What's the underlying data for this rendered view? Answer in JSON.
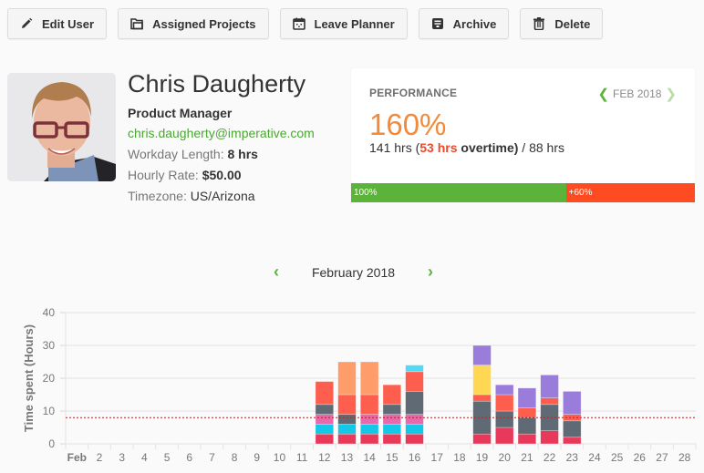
{
  "toolbar": {
    "buttons": [
      {
        "label": "Edit User",
        "icon": "pencil-icon"
      },
      {
        "label": "Assigned Projects",
        "icon": "folder-icon"
      },
      {
        "label": "Leave Planner",
        "icon": "calendar-icon"
      },
      {
        "label": "Archive",
        "icon": "archive-icon"
      },
      {
        "label": "Delete",
        "icon": "trash-icon"
      }
    ]
  },
  "profile": {
    "name": "Chris Daugherty",
    "title": "Product Manager",
    "email": "chris.daugherty@imperative.com",
    "workday_label": "Workday Length:",
    "workday_value": "8 hrs",
    "rate_label": "Hourly Rate:",
    "rate_value": "$50.00",
    "timezone_label": "Timezone:",
    "timezone_value": "US/Arizona"
  },
  "performance": {
    "heading": "PERFORMANCE",
    "period": "FEB 2018",
    "percent": "160%",
    "hours_total": "141 hrs (",
    "overtime_hours": "53 hrs",
    "overtime_label": " overtime)",
    "expected": " / 88 hrs",
    "bar": {
      "base_label": "100%",
      "over_label": "+60%",
      "base_fraction": 0.625,
      "over_fraction": 0.375,
      "base_color": "#5cb33a",
      "over_color": "#fe4b21"
    }
  },
  "calendar": {
    "month_label": "February 2018",
    "prev_icon": "chevron-left-icon",
    "next_icon": "chevron-right-icon"
  },
  "chart_data": {
    "type": "bar",
    "stacked": true,
    "ylabel": "Time spent (Hours)",
    "xlabel": "",
    "ylim": [
      0,
      40
    ],
    "yticks": [
      0,
      10,
      20,
      30,
      40
    ],
    "grid": true,
    "reference_line": {
      "value": 8,
      "style": "dotted",
      "color": "#b22222"
    },
    "categories": [
      "Feb",
      "2",
      "3",
      "4",
      "5",
      "6",
      "7",
      "8",
      "9",
      "10",
      "11",
      "12",
      "13",
      "14",
      "15",
      "16",
      "17",
      "18",
      "19",
      "20",
      "21",
      "22",
      "23",
      "24",
      "25",
      "26",
      "27",
      "28"
    ],
    "series": [
      {
        "name": "crimson",
        "color": "#e8395a",
        "values": [
          0,
          0,
          0,
          0,
          0,
          0,
          0,
          0,
          0,
          0,
          0,
          3,
          3,
          3,
          3,
          3,
          0,
          0,
          3,
          5,
          3,
          4,
          2,
          0,
          0,
          0,
          0,
          0
        ]
      },
      {
        "name": "cyan",
        "color": "#13c8e6",
        "values": [
          0,
          0,
          0,
          0,
          0,
          0,
          0,
          0,
          0,
          0,
          0,
          3,
          3,
          3,
          3,
          3,
          0,
          0,
          0,
          0,
          0,
          0,
          0,
          0,
          0,
          0,
          0,
          0
        ]
      },
      {
        "name": "pink",
        "color": "#e569ab",
        "values": [
          0,
          0,
          0,
          0,
          0,
          0,
          0,
          0,
          0,
          0,
          0,
          3,
          0,
          3,
          3,
          3,
          0,
          0,
          0,
          0,
          0,
          0,
          0,
          0,
          0,
          0,
          0,
          0
        ]
      },
      {
        "name": "slate",
        "color": "#5f6a74",
        "values": [
          0,
          0,
          0,
          0,
          0,
          0,
          0,
          0,
          0,
          0,
          0,
          3,
          3,
          0,
          3,
          7,
          0,
          0,
          10,
          5,
          5,
          8,
          5,
          0,
          0,
          0,
          0,
          0
        ]
      },
      {
        "name": "red",
        "color": "#fe5e4e",
        "values": [
          0,
          0,
          0,
          0,
          0,
          0,
          0,
          0,
          0,
          0,
          0,
          7,
          6,
          6,
          6,
          6,
          0,
          0,
          2,
          5,
          3,
          2,
          2,
          0,
          0,
          0,
          0,
          0
        ]
      },
      {
        "name": "salmon",
        "color": "#ff9d6a",
        "values": [
          0,
          0,
          0,
          0,
          0,
          0,
          0,
          0,
          0,
          0,
          0,
          0,
          10,
          10,
          0,
          0,
          0,
          0,
          0,
          0,
          0,
          0,
          0,
          0,
          0,
          0,
          0,
          0
        ]
      },
      {
        "name": "sky",
        "color": "#52daf5",
        "values": [
          0,
          0,
          0,
          0,
          0,
          0,
          0,
          0,
          0,
          0,
          0,
          0,
          0,
          0,
          0,
          2,
          0,
          0,
          0,
          0,
          0,
          0,
          0,
          0,
          0,
          0,
          0,
          0
        ]
      },
      {
        "name": "yellow",
        "color": "#ffd752",
        "values": [
          0,
          0,
          0,
          0,
          0,
          0,
          0,
          0,
          0,
          0,
          0,
          0,
          0,
          0,
          0,
          0,
          0,
          0,
          9,
          0,
          0,
          0,
          0,
          0,
          0,
          0,
          0,
          0
        ]
      },
      {
        "name": "purple",
        "color": "#9a7cdb",
        "values": [
          0,
          0,
          0,
          0,
          0,
          0,
          0,
          0,
          0,
          0,
          0,
          0,
          0,
          0,
          0,
          0,
          0,
          0,
          6,
          3,
          6,
          7,
          7,
          0,
          0,
          0,
          0,
          0
        ]
      }
    ]
  }
}
